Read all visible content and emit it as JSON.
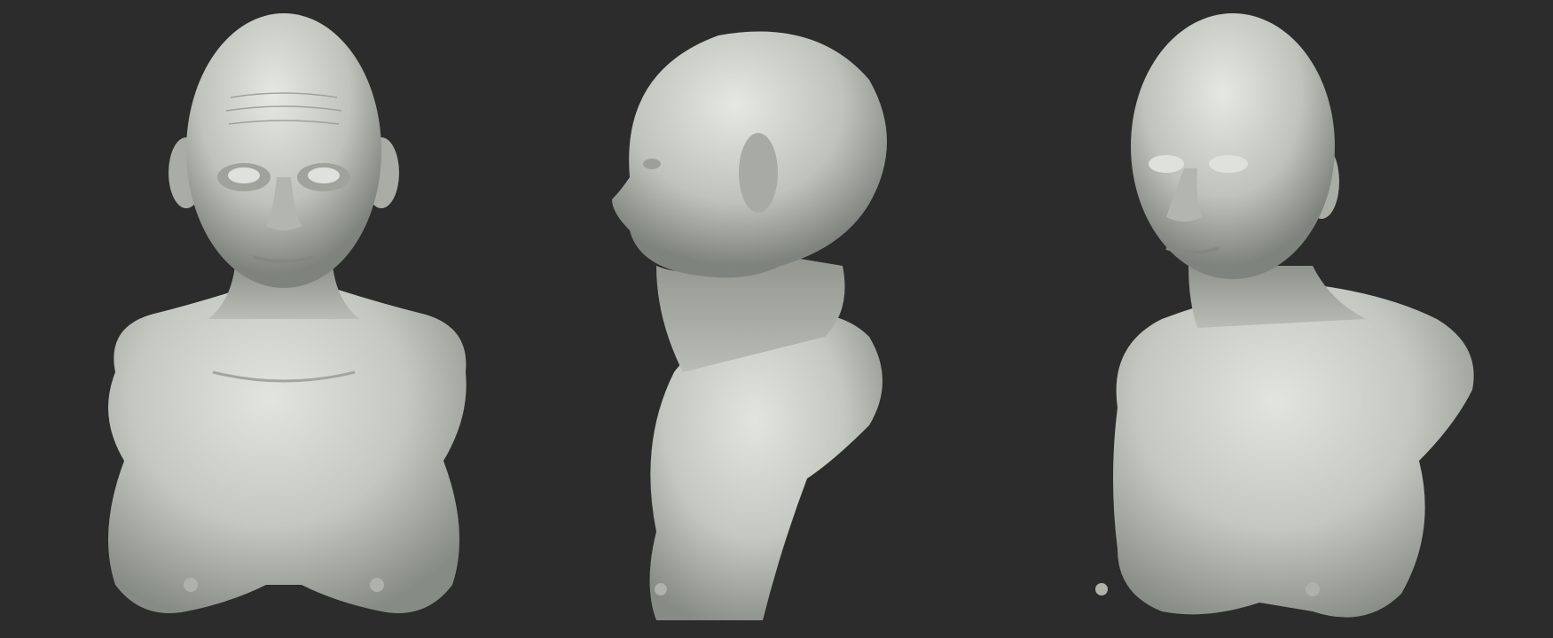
{
  "scene": {
    "background_color": "#2c2c2c",
    "material_color": "#c9cdc6",
    "shadow_color": "#8e928b",
    "highlight_color": "#e4e7e1",
    "rim_tint": "#b69aa3"
  },
  "views": [
    {
      "id": "front",
      "angle": "front"
    },
    {
      "id": "side",
      "angle": "profile-left"
    },
    {
      "id": "three-quarter",
      "angle": "three-quarter-left"
    }
  ]
}
